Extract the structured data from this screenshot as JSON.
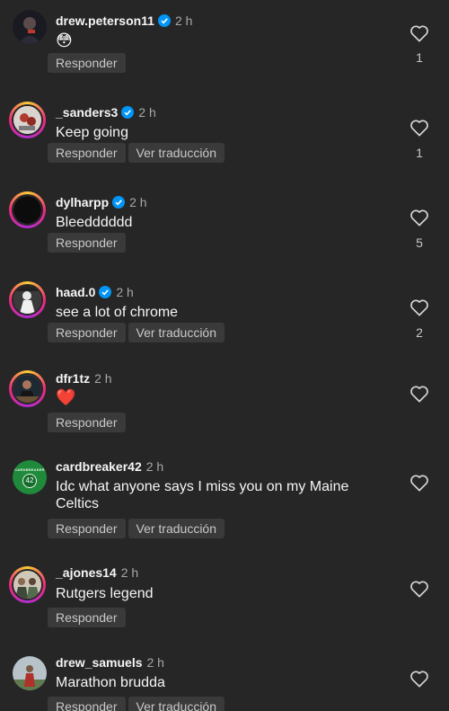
{
  "comments": [
    {
      "username": "drew.peterson11",
      "verified": true,
      "time": "2 h",
      "text": "😳",
      "reply_label": "Responder",
      "translate_label": "",
      "likes": "1"
    },
    {
      "username": "_sanders3",
      "verified": true,
      "time": "2 h",
      "text": "Keep going",
      "reply_label": "Responder",
      "translate_label": "Ver traducción",
      "likes": "1"
    },
    {
      "username": "dylharpp",
      "verified": true,
      "time": "2 h",
      "text": "Bleedddddd",
      "reply_label": "Responder",
      "translate_label": "",
      "likes": "5"
    },
    {
      "username": "haad.0",
      "verified": true,
      "time": "2 h",
      "text": "see a lot of chrome",
      "reply_label": "Responder",
      "translate_label": "Ver traducción",
      "likes": "2"
    },
    {
      "username": "dfr1tz",
      "verified": false,
      "time": "2 h",
      "text": "❤️",
      "reply_label": "Responder",
      "translate_label": "",
      "likes": ""
    },
    {
      "username": "cardbreaker42",
      "verified": false,
      "time": "2 h",
      "text": "Idc what anyone says I miss you on my Maine Celtics",
      "reply_label": "Responder",
      "translate_label": "Ver traducción",
      "likes": ""
    },
    {
      "username": "_ajones14",
      "verified": false,
      "time": "2 h",
      "text": "Rutgers legend",
      "reply_label": "Responder",
      "translate_label": "",
      "likes": ""
    },
    {
      "username": "drew_samuels",
      "verified": false,
      "time": "2 h",
      "text": "Marathon brudda",
      "reply_label": "Responder",
      "translate_label": "Ver traducción",
      "likes": ""
    }
  ],
  "avatar_badge_text": "42",
  "avatar_brand_text": "CARDBREAKER",
  "icons": {
    "verified": "verified-badge-icon",
    "like": "heart-outline-icon"
  },
  "colors": {
    "background": "#262626",
    "verified": "#0095f6",
    "pill": "#3a3a3a",
    "muted": "#a8a8a8"
  }
}
